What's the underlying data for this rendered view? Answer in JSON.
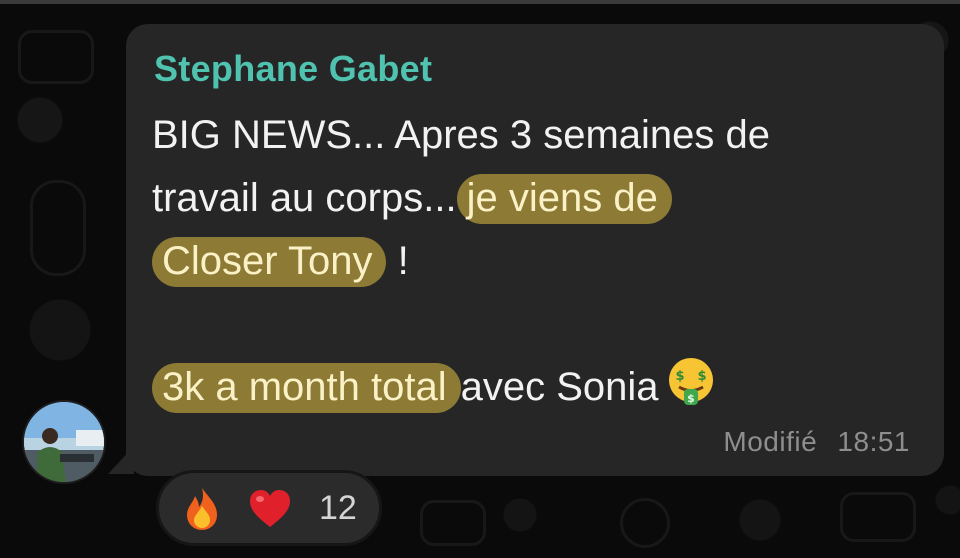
{
  "message": {
    "sender": "Stephane Gabet",
    "line1": "BIG NEWS... Apres 3 semaines de",
    "line2_plain": "travail au corps...",
    "line2_highlight": "je viens de",
    "line3_highlight": "Closer Tony",
    "line3_plain": "!",
    "line4_highlight": "3k a month total",
    "line4_plain": "avec Sonia",
    "emoji": "money-mouth-face-icon",
    "edited_label": "Modifié",
    "time": "18:51"
  },
  "reactions": {
    "items": [
      {
        "icon": "fire-icon"
      },
      {
        "icon": "red-heart-icon"
      }
    ],
    "count": "12"
  },
  "colors": {
    "bubble": "#262626",
    "sender_name": "#4fc3b0",
    "highlight": "#8c7a35",
    "highlight_text": "#fbf1c6",
    "meta_text": "#8e8e8e"
  }
}
